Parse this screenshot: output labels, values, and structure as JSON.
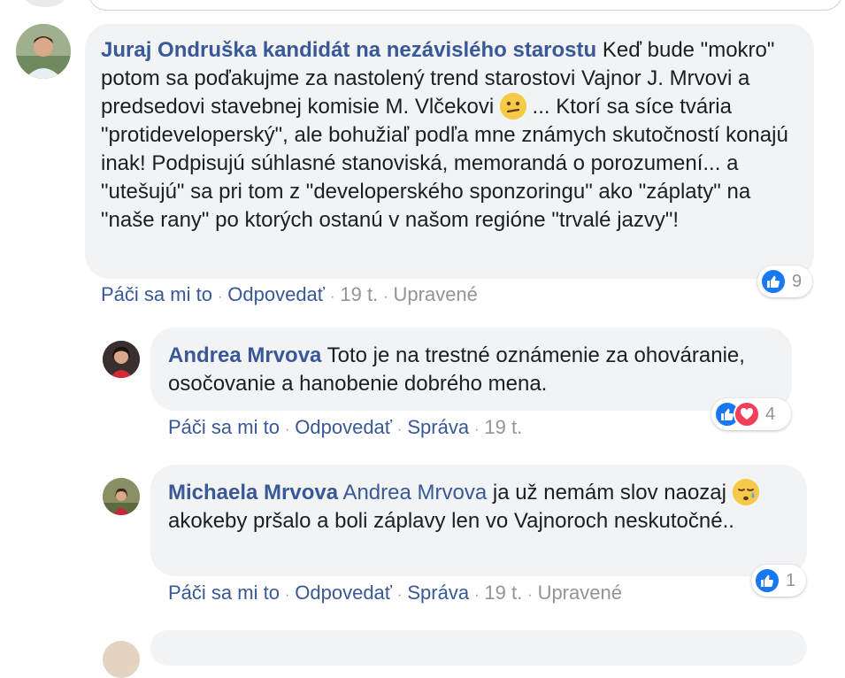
{
  "comments": [
    {
      "author": "Juraj Ondruška kandidát na nezávislého starostu",
      "text_part1": " Keď bude \"mokro\" potom sa poďakujme za nastolený trend starostovi Vajnor J. Mrvovi a predsedovi stavebnej komisie M. Vlčekovi ",
      "emoji": "confused-face",
      "text_part2": " ... Ktorí sa síce tvária \"protideveloperský\", ale bohužiaľ podľa mne známych skutočností konajú inak! Podpisujú súhlasné stanoviská, memorandá o porozumení... a \"utešujú\" sa pri tom z \"developerského sponzoringu\" ako \"záplaty\" na \"naše rany\" po ktorých ostanú v našom regióne \"trvalé jazvy\"!",
      "actions": {
        "like": "Páči sa mi to",
        "reply": "Odpovedať",
        "time": "19 t.",
        "edited": "Upravené"
      },
      "reactions": {
        "count": "9",
        "types": [
          "like"
        ]
      }
    },
    {
      "author": "Andrea Mrvova",
      "text": " Toto je na trestné oznámenie za ohováranie, osočovanie a hanobenie dobrého mena.",
      "actions": {
        "like": "Páči sa mi to",
        "reply": "Odpovedať",
        "message": "Správa",
        "time": "19 t."
      },
      "reactions": {
        "count": "4",
        "types": [
          "like",
          "love"
        ]
      }
    },
    {
      "author": "Michaela Mrvova",
      "mention": "Andrea Mrvova",
      "text_part1": " ja už nemám slov naozaj ",
      "emoji": "sleepy-face",
      "text_part2": " akokeby pršalo a boli záplavy len vo Vajnoroch neskutočné..",
      "actions": {
        "like": "Páči sa mi to",
        "reply": "Odpovedať",
        "message": "Správa",
        "time": "19 t.",
        "edited": "Upravené"
      },
      "reactions": {
        "count": "1",
        "types": [
          "like"
        ]
      }
    }
  ],
  "colors": {
    "link": "#385898",
    "meta": "#90949c",
    "bubble": "#f2f3f5",
    "like": "#1877f2",
    "love": "#f33e58"
  }
}
